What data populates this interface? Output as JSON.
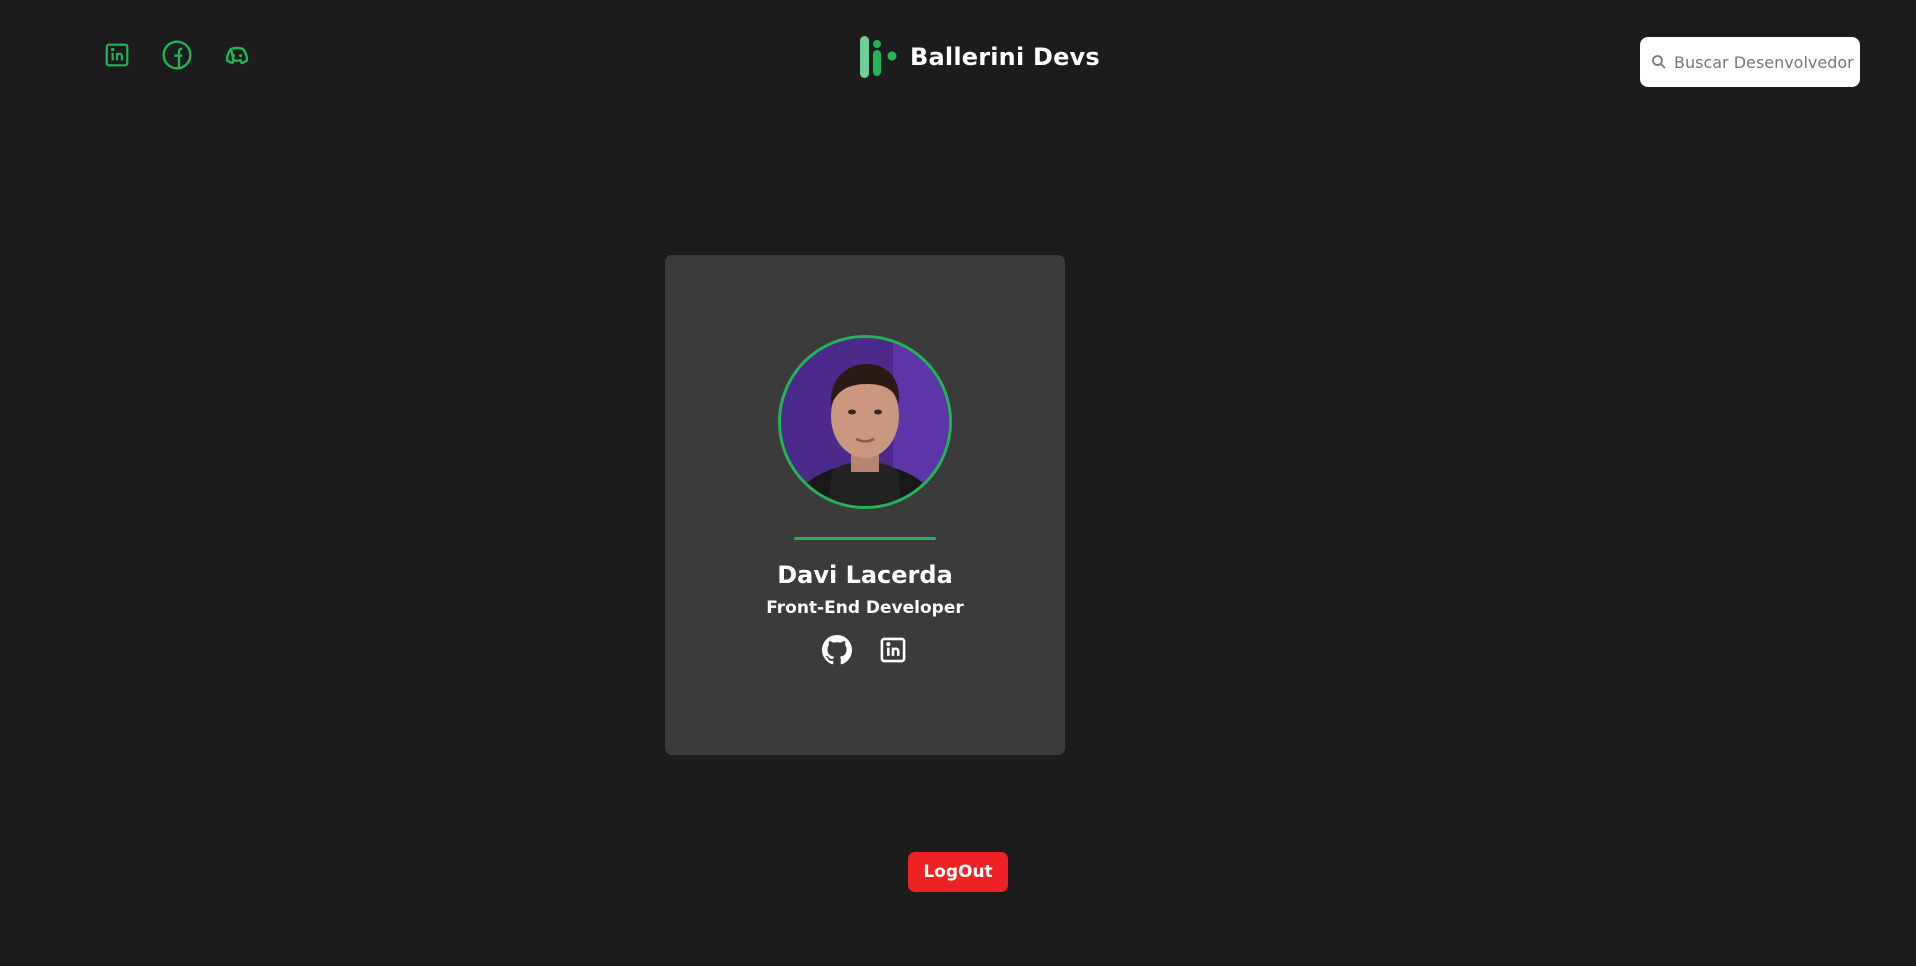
{
  "header": {
    "social_icons": [
      "linkedin-icon",
      "facebook-icon",
      "discord-icon"
    ],
    "brand": {
      "logo": "ballerini-logo",
      "title": "Ballerini Devs"
    },
    "search": {
      "icon": "search-icon",
      "placeholder": "Buscar Desenvolvedor",
      "value": ""
    }
  },
  "profile": {
    "avatar_alt": "Davi Lacerda",
    "name": "Davi Lacerda",
    "role": "Front-End Developer",
    "links": [
      "github-icon",
      "linkedin-icon"
    ]
  },
  "logout": {
    "label": "LogOut"
  },
  "colors": {
    "background": "#1c1c1c",
    "card": "#3b3b3b",
    "accent": "#22b455",
    "logout": "#ee2124"
  }
}
